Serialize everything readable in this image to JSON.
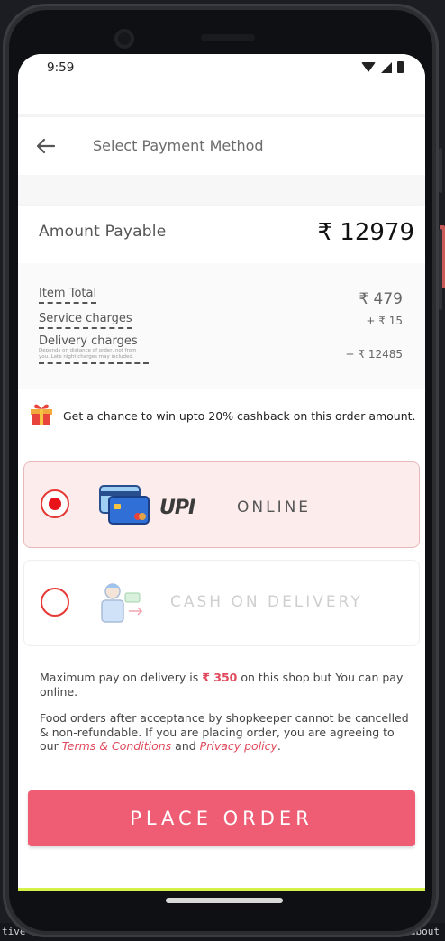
{
  "status_bar": {
    "time": "9:59"
  },
  "header": {
    "title": "Select Payment Method"
  },
  "amount": {
    "label": "Amount Payable",
    "value": "₹ 12979"
  },
  "breakdown": {
    "item_total_label": "Item Total",
    "item_total_value": "₹ 479",
    "service_label": "Service charges",
    "service_value": "+ ₹ 15",
    "delivery_label": "Delivery charges",
    "delivery_note": "Depends on distance of order, not from you. Late night charges may included.",
    "delivery_value": "+ ₹ 12485"
  },
  "cashback": {
    "text": "Get a chance to win upto 20% cashback on this order amount."
  },
  "payment_options": [
    {
      "label": "ONLINE",
      "logo_text": "UPI",
      "selected": true
    },
    {
      "label": "CASH ON DELIVERY",
      "selected": false
    }
  ],
  "notes": {
    "max_pay_prefix": "Maximum pay on delivery is",
    "max_pay_amount": "₹ 350",
    "max_pay_suffix": "on this shop but You can pay online.",
    "policy_text": "Food orders after acceptance by shopkeeper cannot be cancelled & non-refundable. If you are placing order, you are agreeing to our",
    "terms_link": "Terms & Conditions",
    "and_text": "and",
    "privacy_link": "Privacy policy",
    "end": "."
  },
  "place_order_label": "PLACE ORDER",
  "colors": {
    "accent": "#ee5d73",
    "radio_selected": "#e8141a",
    "selected_bg": "#fcecec"
  },
  "background_terminal": {
    "left_text": "tive co",
    "right_text": "s about"
  }
}
